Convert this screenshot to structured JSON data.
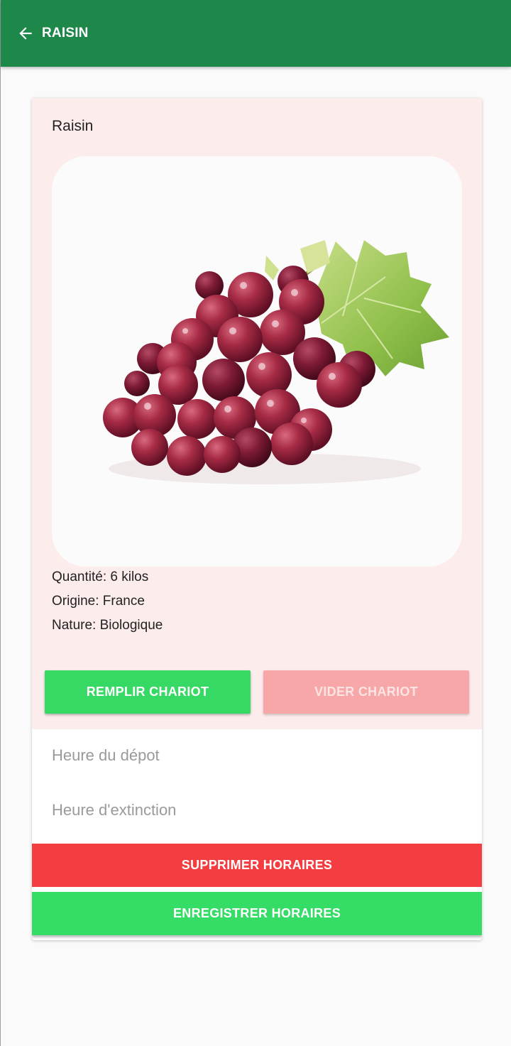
{
  "app_bar": {
    "title": "RAISIN",
    "back_icon": "arrow-left-icon",
    "color": "#1e874a"
  },
  "product": {
    "name": "Raisin",
    "image_icon": "grapes-image",
    "quantity": "Quantité: 6 kilos",
    "origin": "Origine: France",
    "nature": "Nature: Biologique"
  },
  "cart_actions": {
    "fill_label": "REMPLIR CHARIOT",
    "empty_label": "VIDER CHARIOT"
  },
  "schedule": {
    "deposit_placeholder": "Heure du dépot",
    "extinction_placeholder": "Heure d'extinction",
    "delete_label": "SUPPRIMER HORAIRES",
    "save_label": "ENREGISTRER HORAIRES"
  },
  "colors": {
    "primary": "#1e874a",
    "green_button": "#35d964",
    "pink_button": "#f7a7a7",
    "red_button": "#f43d40",
    "card_tint": "#fdecec"
  }
}
